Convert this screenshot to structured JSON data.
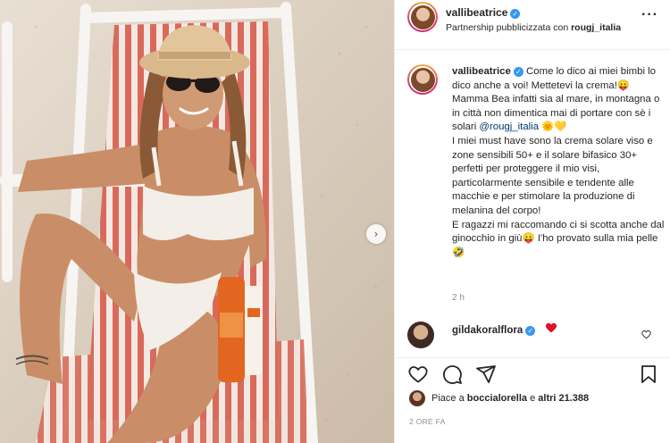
{
  "post": {
    "username": "vallibeatrice",
    "partnership_prefix": "Partnership pubblicizzata con",
    "partner": "rougj_italia",
    "more_icon": "more-dots-icon"
  },
  "caption": {
    "username": "vallibeatrice",
    "part1": "Come lo dico ai miei bimbi lo dico anche a voi! Mettetevi la crema!😛 Mamma Bea infatti sia al mare, in montagna o in città non dimentica mai di portare con sè i solari ",
    "mention": "@rougj_italia",
    "emoji1": " 🌞💛",
    "part2": "\nI miei must have sono la crema solare viso e zone sensibili 50+ e il solare bifasico 30+ perfetti per proteggere il mio visi, particolarmente sensibile e tendente alle macchie e per stimolare la produzione di melanina del corpo!\nE ragazzi mi raccomando ci si scotta anche dal ginocchio in giù😛 I'ho provato sulla mia pelle🤣",
    "time": "2 h"
  },
  "comment": {
    "username": "gildakoralflora",
    "heart": "❤"
  },
  "actions": {
    "icons": [
      "heart-icon",
      "comment-icon",
      "share-icon",
      "bookmark-icon"
    ]
  },
  "likes": {
    "prefix": "Piace a",
    "user": "boccialorella",
    "middle": "e",
    "others": "altri 21.388"
  },
  "post_time": "2 ORE FA",
  "colors": {
    "verified": "#3897f0",
    "link": "#00376b",
    "stripe_red": "#d96a5b",
    "bikini": "#f3eee7"
  }
}
